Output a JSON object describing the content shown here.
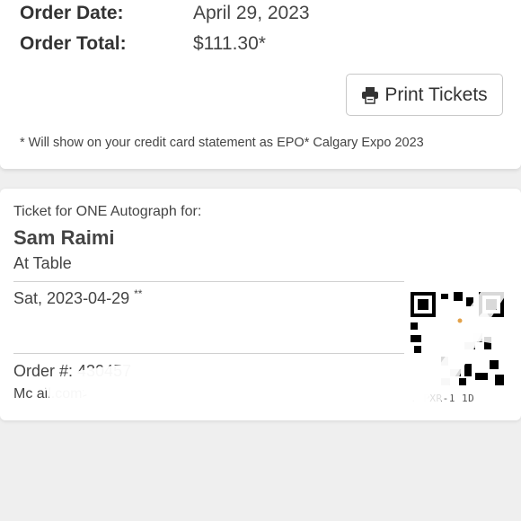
{
  "order": {
    "date_label": "Order Date:",
    "date_value": "April 29, 2023",
    "total_label": "Order Total:",
    "total_value": "$111.30*"
  },
  "print_button": {
    "label": "Print Tickets",
    "icon": "printer-icon"
  },
  "note": "* Will show on your credit card statement as EPO* Calgary Expo 2023",
  "ticket": {
    "intro": "Ticket for ONE Autograph for:",
    "name": "Sam Raimi",
    "location": "At Table",
    "date": "Sat, 2023-04-29",
    "date_marker": "**",
    "order_number": "Order #: 430457",
    "email_line": "Mc                                   ail.com>",
    "code": "T-PXR-1    1D"
  },
  "colors": {
    "page_bg": "#efefef",
    "card_bg": "#ffffff",
    "text": "#444444",
    "divider": "#d0d0d0"
  }
}
